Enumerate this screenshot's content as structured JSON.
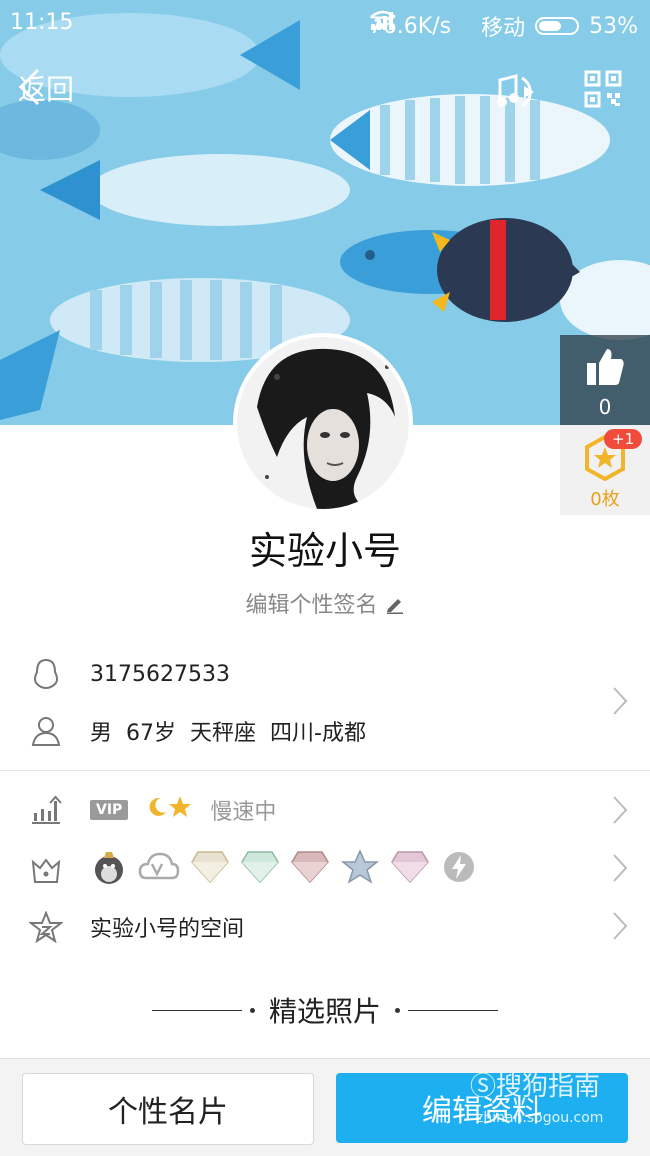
{
  "status": {
    "time": "11:15",
    "speed": "76.6K/s",
    "carrier": "移动",
    "battery": "53%"
  },
  "header": {
    "back_label": "返回",
    "music_icon": "music-play-icon",
    "qr_icon": "qr-code-icon"
  },
  "profile": {
    "name": "实验小号",
    "signature": "编辑个性签名",
    "likes": "0",
    "medals": "0枚",
    "medal_plus": "+1"
  },
  "info": {
    "qq_number": "3175627533",
    "gender": "男",
    "age": "67岁",
    "zodiac": "天秤座",
    "location": "四川-成都"
  },
  "level": {
    "vip_label": "VIP",
    "status": "慢速中"
  },
  "space": {
    "label": "实验小号的空间"
  },
  "section_title": "精选照片",
  "buttons": {
    "card": "个性名片",
    "edit": "编辑资料"
  },
  "watermark": {
    "brand": "搜狗指南",
    "url": "zhinan.sogou.com"
  },
  "colors": {
    "accent": "#1eaff0",
    "like_bg": "#28323c",
    "medal": "#e8a21a",
    "badge_red": "#f24b3c"
  }
}
